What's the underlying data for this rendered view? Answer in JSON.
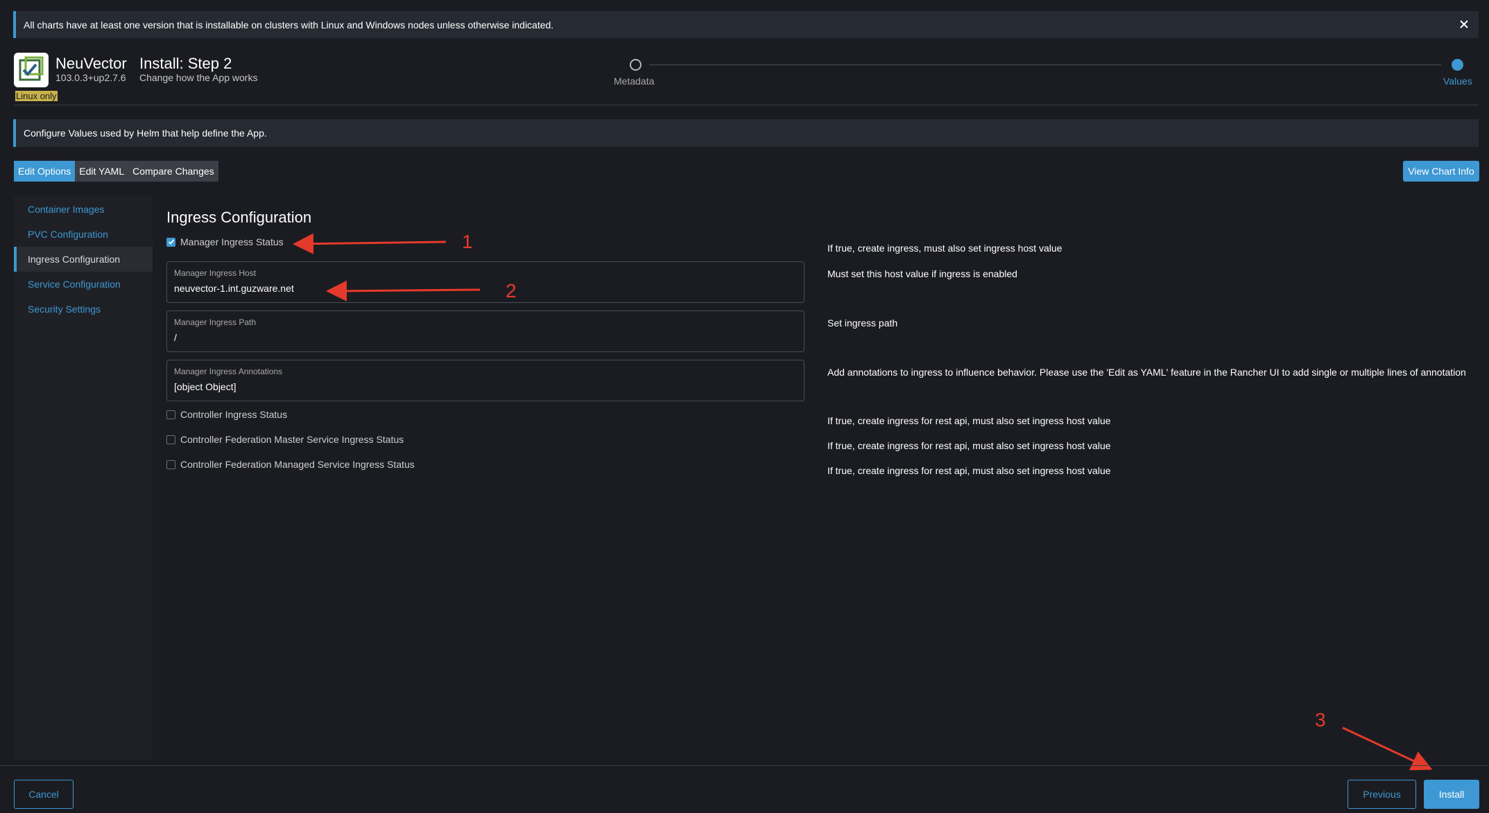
{
  "banner": {
    "text": "All charts have at least one version that is installable on clusters with Linux and Windows nodes unless otherwise indicated."
  },
  "app": {
    "name": "NeuVector",
    "version": "103.0.3+up2.7.6",
    "os_badge": "Linux only"
  },
  "step": {
    "title": "Install: Step 2",
    "subtitle": "Change how the App works",
    "steps": [
      "Metadata",
      "Values"
    ]
  },
  "info_bar": "Configure Values used by Helm that help define the App.",
  "tabs": [
    "Edit Options",
    "Edit YAML",
    "Compare Changes"
  ],
  "view_chart_info": "View Chart Info",
  "sidebar": {
    "items": [
      {
        "label": "Container Images"
      },
      {
        "label": "PVC Configuration"
      },
      {
        "label": "Ingress Configuration"
      },
      {
        "label": "Service Configuration"
      },
      {
        "label": "Security Settings"
      }
    ]
  },
  "section_title": "Ingress Configuration",
  "form": {
    "manager_ingress_status": {
      "label": "Manager Ingress Status",
      "checked": true,
      "description": "If true, create ingress, must also set ingress host value"
    },
    "manager_ingress_host": {
      "label": "Manager Ingress Host",
      "value": "neuvector-1.int.guzware.net",
      "description": "Must set this host value if ingress is enabled"
    },
    "manager_ingress_path": {
      "label": "Manager Ingress Path",
      "value": "/",
      "description": "Set ingress path"
    },
    "manager_ingress_annotations": {
      "label": "Manager Ingress Annotations",
      "value": "[object Object]",
      "description": "Add annotations to ingress to influence behavior. Please use the 'Edit as YAML' feature in the Rancher UI to add single or multiple lines of annotation"
    },
    "controller_ingress_status": {
      "label": "Controller Ingress Status",
      "checked": false,
      "description": "If true, create ingress for rest api, must also set ingress host value"
    },
    "controller_fed_master_ingress": {
      "label": "Controller Federation Master Service Ingress Status",
      "checked": false,
      "description": "If true, create ingress for rest api, must also set ingress host value"
    },
    "controller_fed_managed_ingress": {
      "label": "Controller Federation Managed Service Ingress Status",
      "checked": false,
      "description": "If true, create ingress for rest api, must also set ingress host value"
    }
  },
  "footer": {
    "cancel": "Cancel",
    "previous": "Previous",
    "install": "Install"
  },
  "annotations": [
    "1",
    "2",
    "3"
  ],
  "colors": {
    "accent": "#3d98d3",
    "annotation": "#e53a2b",
    "background": "#1b1c21"
  }
}
